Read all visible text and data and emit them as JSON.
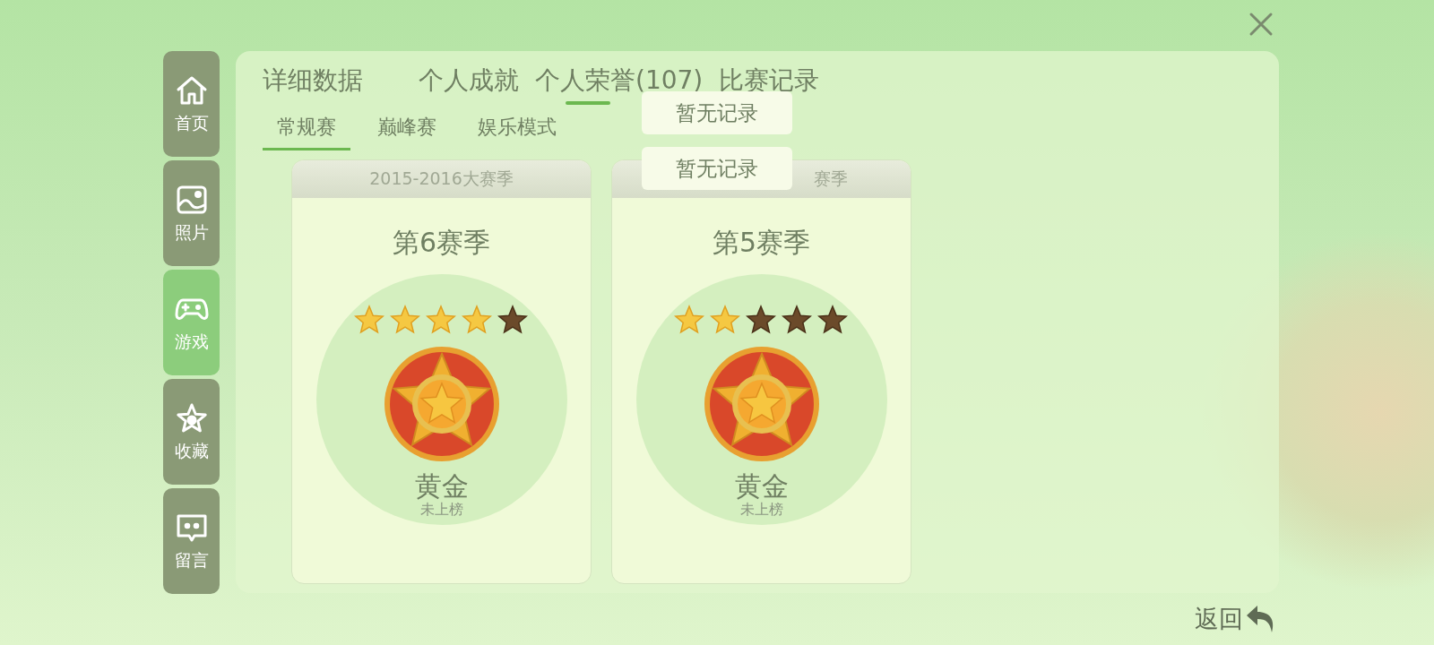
{
  "sidebar": {
    "items": [
      {
        "label": "首页",
        "selected": false
      },
      {
        "label": "照片",
        "selected": false
      },
      {
        "label": "游戏",
        "selected": true
      },
      {
        "label": "收藏",
        "selected": false
      },
      {
        "label": "留言",
        "selected": false
      }
    ]
  },
  "tabs": [
    {
      "label": "详细数据",
      "selected": false
    },
    {
      "label": "个人成就",
      "selected": false
    },
    {
      "label": "个人荣誉(107)",
      "selected": true
    },
    {
      "label": "比赛记录",
      "selected": false
    }
  ],
  "subtabs": [
    {
      "label": "常规赛",
      "selected": true
    },
    {
      "label": "巅峰赛",
      "selected": false
    },
    {
      "label": "娱乐模式",
      "selected": false
    }
  ],
  "popups": [
    "暂无记录",
    "暂无记录"
  ],
  "cards": [
    {
      "header": "2015-2016大赛季",
      "season": "第6赛季",
      "stars": 4,
      "rank": "黄金",
      "status": "未上榜"
    },
    {
      "header": "赛季",
      "season": "第5赛季",
      "stars": 2,
      "rank": "黄金",
      "status": "未上榜"
    }
  ],
  "back": "返回"
}
